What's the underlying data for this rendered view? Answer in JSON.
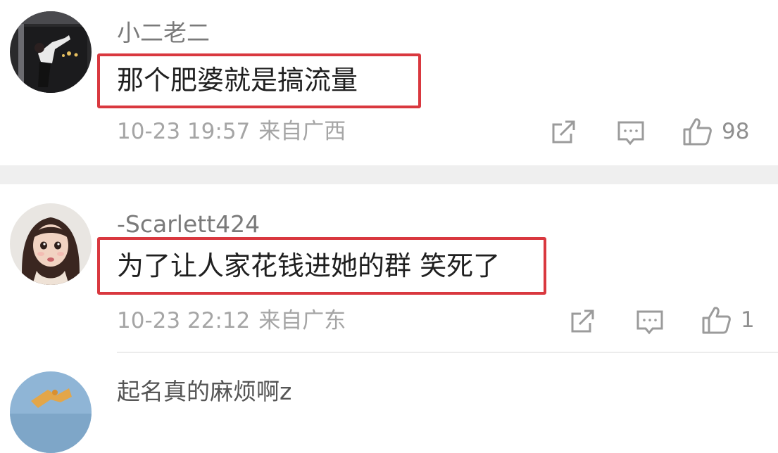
{
  "comments": [
    {
      "username": "小二老二",
      "text": "那个肥婆就是搞流量",
      "time": "10-23 19:57",
      "location": "来自广西",
      "likes": "98"
    },
    {
      "username": "-Scarlett424",
      "text": "为了让人家花钱进她的群 笑死了",
      "time": "10-23 22:12",
      "location": "来自广东",
      "likes": "1"
    },
    {
      "username": "起名真的麻烦啊z"
    }
  ],
  "icons": {
    "share": "share-icon",
    "comment": "comment-icon",
    "like": "thumbs-up-icon"
  },
  "colors": {
    "highlight_border": "#d9383f",
    "username": "#7a7a7a",
    "meta": "#a5a5a5",
    "separator": "#efefef"
  }
}
